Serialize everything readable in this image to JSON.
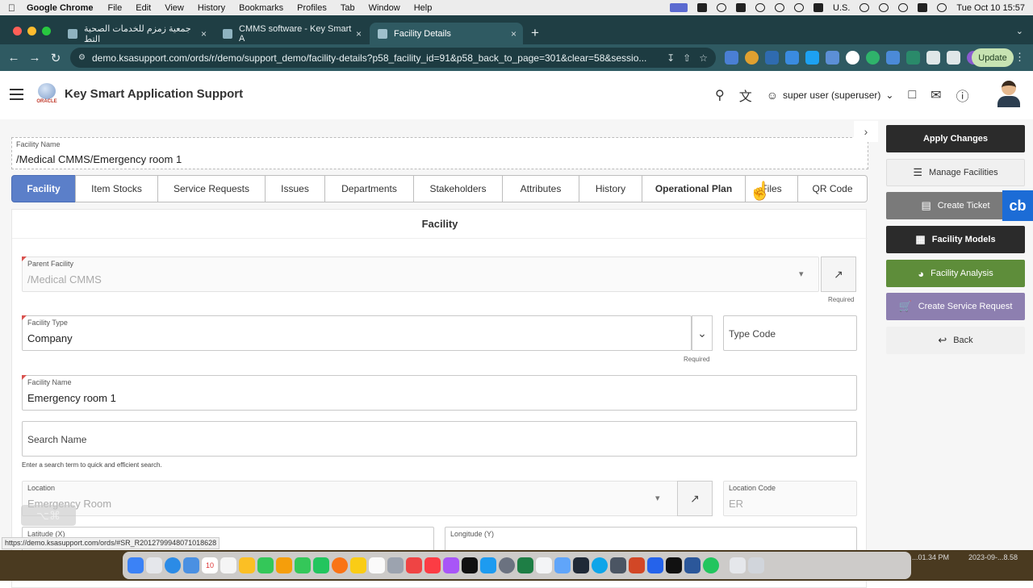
{
  "menubar": {
    "app": "Google Chrome",
    "items": [
      "File",
      "Edit",
      "View",
      "History",
      "Bookmarks",
      "Profiles",
      "Tab",
      "Window",
      "Help"
    ],
    "input_source": "U.S.",
    "clock": "Tue Oct 10  15:57"
  },
  "browser": {
    "tabs": [
      {
        "title": "جمعية زمزم للخدمات الصحية التط",
        "close": "×"
      },
      {
        "title": "CMMS software - Key Smart A",
        "close": "×"
      },
      {
        "title": "Facility Details",
        "close": "×"
      }
    ],
    "url": "demo.ksasupport.com/ords/r/demo/support_demo/facility-details?p58_facility_id=91&p58_back_to_page=301&clear=58&sessio...",
    "update_label": "Update"
  },
  "header": {
    "title": "Key Smart Application Support",
    "logo_text": "ORACLE",
    "user": "super user (superuser)"
  },
  "facility_name": {
    "label": "Facility Name",
    "value": "/Medical CMMS/Emergency room 1"
  },
  "tabs": [
    "Facility",
    "Item Stocks",
    "Service Requests",
    "Issues",
    "Departments",
    "Stakeholders",
    "Attributes",
    "History",
    "Operational Plan",
    "Files",
    "QR Code"
  ],
  "region": {
    "title": "Facility",
    "parent_facility": {
      "label": "Parent Facility",
      "value": "/Medical CMMS",
      "required": "Required"
    },
    "facility_type": {
      "label": "Facility Type",
      "value": "Company",
      "required": "Required"
    },
    "type_code": {
      "label": "Type Code"
    },
    "facility_name": {
      "label": "Facility Name",
      "value": "Emergency room 1"
    },
    "search_name": {
      "label": "Search Name",
      "help": "Enter a search term to quick and efficient search."
    },
    "location": {
      "label": "Location",
      "value": "Emergency Room"
    },
    "location_code": {
      "label": "Location Code",
      "value": "ER"
    },
    "latitude": {
      "label": "Latitude (X)"
    },
    "longitude": {
      "label": "Longitude (Y)"
    }
  },
  "actions": [
    {
      "label": "Apply Changes",
      "color": "#2b2b2b"
    },
    {
      "label": "Manage Facilities",
      "color": "#f0f0f0"
    },
    {
      "label": "Create Ticket",
      "color": "#7a7a7a"
    },
    {
      "label": "Facility Models",
      "color": "#2b2b2b"
    },
    {
      "label": "Facility Analysis",
      "color": "#5e8d3a"
    },
    {
      "label": "Create Service Request",
      "color": "#8d7fb0"
    },
    {
      "label": "Back",
      "color": "#f0f0f0"
    }
  ],
  "cb_badge": "cb",
  "status_url": "https://demo.ksasupport.com/ords/#SR_R2012799948071018628",
  "dock": {
    "calendar_day": "10",
    "right_text_1": "...01.34 PM",
    "right_text_2": "2023-09-...8.58"
  }
}
